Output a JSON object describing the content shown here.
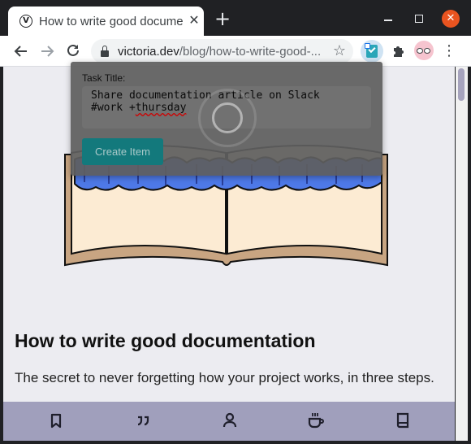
{
  "browser": {
    "tab_title": "How to write good documentation",
    "tab_favicon_letter": "V",
    "close_tab": "✕",
    "new_tab": "+",
    "url_host": "victoria.dev",
    "url_path": "/blog/how-to-write-good-..."
  },
  "popup": {
    "label": "Task Title:",
    "line1": "Share documentation article on Slack",
    "line2_prefix": "#work +",
    "line2_word": "thursday",
    "button_label": "Create Item"
  },
  "article": {
    "title": "How to write good documentation",
    "subtitle": "The secret to never forgetting how your project works, in three steps."
  },
  "bottom_nav": [
    {
      "icon": "bookmark-icon"
    },
    {
      "icon": "quote-icon"
    },
    {
      "icon": "person-icon"
    },
    {
      "icon": "coffee-icon"
    },
    {
      "icon": "book-icon"
    }
  ],
  "colors": {
    "accent_teal": "#13797c",
    "bottom_bar": "#a09fbc",
    "page_bg": "#ececf1",
    "close_button": "#e95420"
  }
}
